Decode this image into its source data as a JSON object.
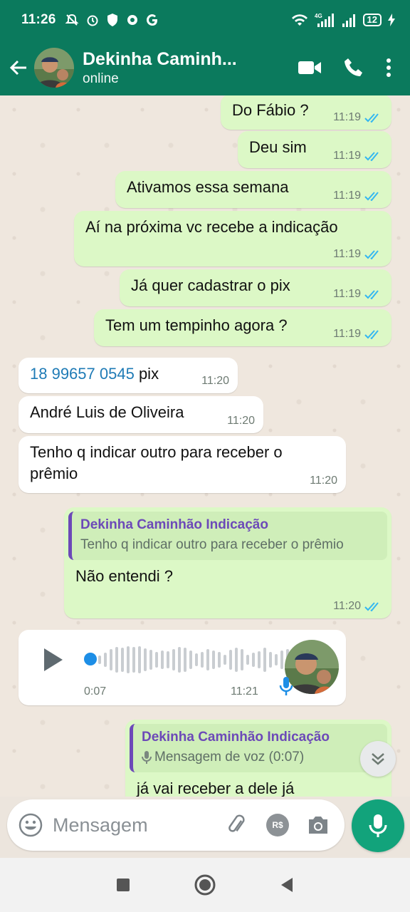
{
  "status_bar": {
    "time": "11:26",
    "battery": "12",
    "network": "4G"
  },
  "header": {
    "contact_name": "Dekinha Caminh...",
    "status": "online"
  },
  "messages": [
    {
      "dir": "out",
      "text": "Do Fábio ?",
      "time": "11:19"
    },
    {
      "dir": "out",
      "text": "Deu sim",
      "time": "11:19"
    },
    {
      "dir": "out",
      "text": "Ativamos essa semana",
      "time": "11:19"
    },
    {
      "dir": "out",
      "text": "Aí na próxima vc recebe a indicação",
      "time": "11:19"
    },
    {
      "dir": "out",
      "text": "Já quer cadastrar o pix",
      "time": "11:19"
    },
    {
      "dir": "out",
      "text": "Tem um tempinho agora ?",
      "time": "11:19"
    },
    {
      "dir": "in",
      "link": "18 99657 0545",
      "text": " pix",
      "time": "11:20"
    },
    {
      "dir": "in",
      "text": "André Luis de Oliveira",
      "time": "11:20"
    },
    {
      "dir": "in",
      "text": "Tenho q indicar  outro para receber  o prêmio",
      "time": "11:20"
    },
    {
      "dir": "out",
      "quote_author": "Dekinha Caminhão Indicação",
      "quote_text": "Tenho q indicar  outro para receber  o prêmio",
      "text": "Não entendi ?",
      "time": "11:20"
    },
    {
      "dir": "in",
      "type": "voice",
      "duration": "0:07",
      "time": "11:21"
    },
    {
      "dir": "out",
      "quote_author": "Dekinha Caminhão Indicação",
      "quote_text": "Mensagem de voz (0:07)",
      "text": "já vai receber a dele já"
    }
  ],
  "composer": {
    "placeholder": "Mensagem",
    "currency_label": "R$"
  },
  "colors": {
    "header": "#0b7a5d",
    "outgoing": "#dcf8c6",
    "incoming": "#ffffff",
    "read_ticks": "#34b7f1",
    "quote_accent": "#6c49b8",
    "send_button": "#12a37b"
  }
}
